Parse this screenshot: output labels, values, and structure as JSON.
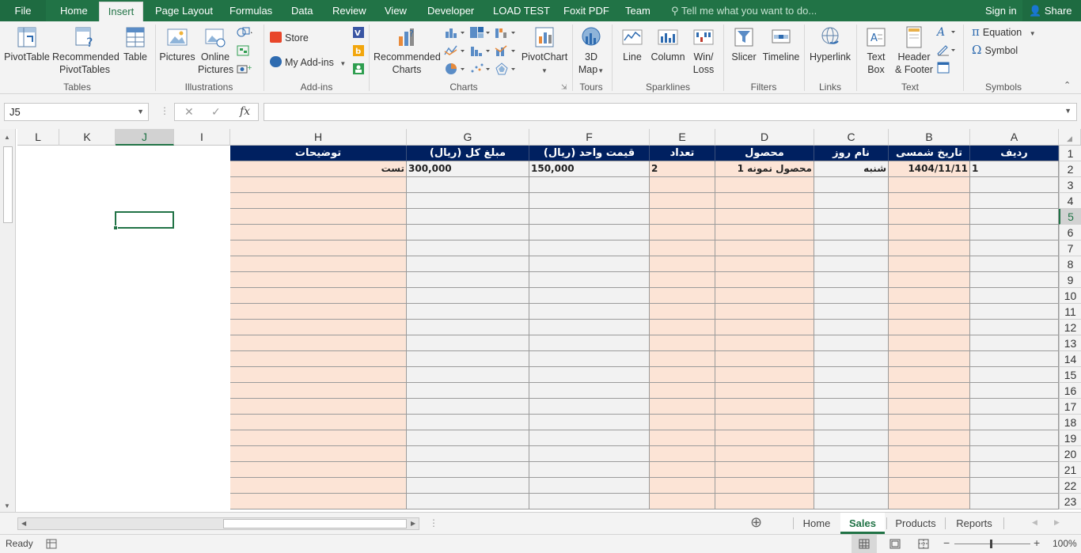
{
  "menu": {
    "tabs": [
      "File",
      "Home",
      "Insert",
      "Page Layout",
      "Formulas",
      "Data",
      "Review",
      "View",
      "Developer",
      "LOAD TEST",
      "Foxit PDF",
      "Team"
    ],
    "active_tab": "Insert",
    "tell_me": "Tell me what you want to do...",
    "sign_in": "Sign in",
    "share": "Share"
  },
  "ribbon": {
    "pivottable": "PivotTable",
    "recommended_pivottables_1": "Recommended",
    "recommended_pivottables_2": "PivotTables",
    "table": "Table",
    "pictures": "Pictures",
    "online_pictures_1": "Online",
    "online_pictures_2": "Pictures",
    "store": "Store",
    "my_addins": "My Add-ins",
    "recommended_charts_1": "Recommended",
    "recommended_charts_2": "Charts",
    "pivotchart": "PivotChart",
    "map3d_1": "3D",
    "map3d_2": "Map",
    "line": "Line",
    "column": "Column",
    "winloss_1": "Win/",
    "winloss_2": "Loss",
    "slicer": "Slicer",
    "timeline": "Timeline",
    "hyperlink": "Hyperlink",
    "textbox_1": "Text",
    "textbox_2": "Box",
    "header_footer_1": "Header",
    "header_footer_2": "& Footer",
    "equation": "Equation",
    "symbol": "Symbol",
    "groups": {
      "tables": "Tables",
      "illustrations": "Illustrations",
      "addins": "Add-ins",
      "charts": "Charts",
      "tours": "Tours",
      "sparklines": "Sparklines",
      "filters": "Filters",
      "links": "Links",
      "text": "Text",
      "symbols": "Symbols"
    }
  },
  "formula_bar": {
    "name_box": "J5",
    "formula": ""
  },
  "columns": [
    "L",
    "K",
    "J",
    "I",
    "H",
    "G",
    "F",
    "E",
    "D",
    "C",
    "B",
    "A"
  ],
  "selected_column": "J",
  "selected_row": "5",
  "rows": [
    "1",
    "2",
    "3",
    "4",
    "5",
    "6",
    "7",
    "8",
    "9",
    "10",
    "11",
    "12",
    "13",
    "14",
    "15",
    "16",
    "17",
    "18",
    "19",
    "20",
    "21",
    "22",
    "23"
  ],
  "table": {
    "headers": {
      "A": "ردیف",
      "B": "تاریخ شمسی",
      "C": "نام روز",
      "D": "محصول",
      "E": "تعداد",
      "F": "قیمت واحد (ریال)",
      "G": "مبلغ کل (ریال)",
      "H": "توضیحات"
    },
    "row2": {
      "A": "1",
      "B": "1404/11/11",
      "C": "شنبه",
      "D": "محصول نمونه 1",
      "E": "2",
      "F": "150,000",
      "G": "300,000",
      "H": "تست"
    }
  },
  "sheets": [
    "Home",
    "Sales",
    "Products",
    "Reports"
  ],
  "active_sheet": "Sales",
  "status": {
    "ready": "Ready",
    "zoom": "100%"
  },
  "colors": {
    "accent": "#217346",
    "header_fill": "#002060",
    "peach_fill": "#fce4d6",
    "gray_fill": "#f2f2f2"
  }
}
